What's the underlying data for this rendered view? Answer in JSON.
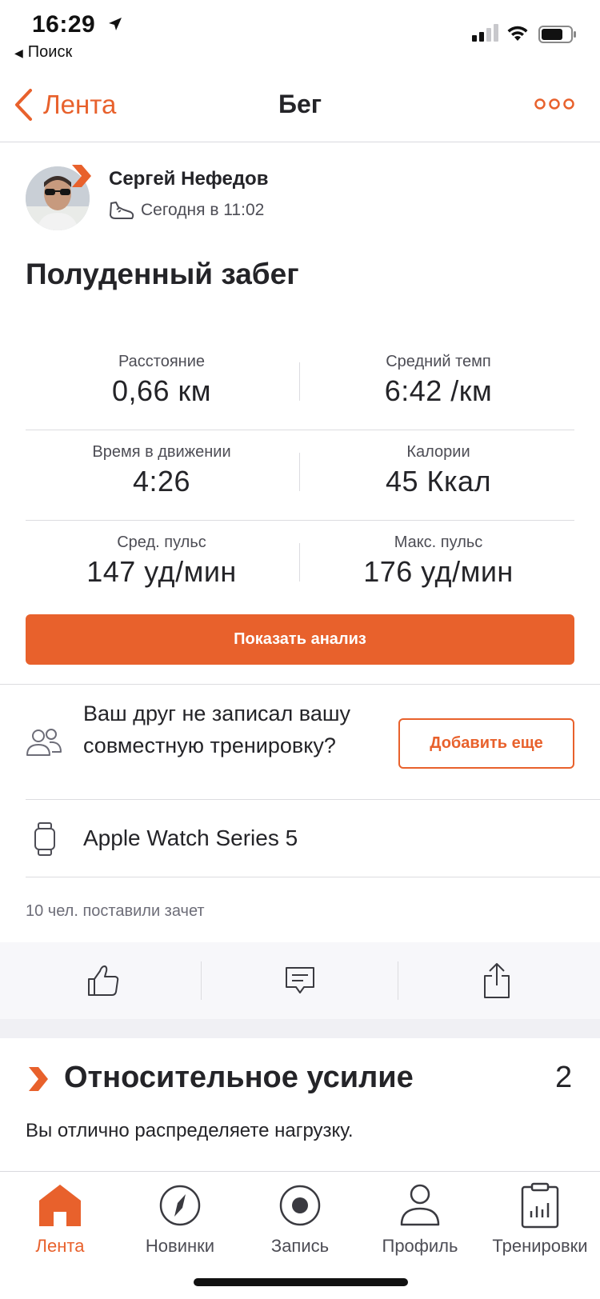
{
  "status_bar": {
    "time": "16:29",
    "back_app": "Поиск"
  },
  "nav": {
    "back_label": "Лента",
    "title": "Бег"
  },
  "author": {
    "name": "Сергей Нефедов",
    "date": "Сегодня в 11:02"
  },
  "activity": {
    "title": "Полуденный забег",
    "stats": [
      {
        "label": "Расстояние",
        "value": "0,66 км"
      },
      {
        "label": "Средний темп",
        "value": "6:42 /км"
      },
      {
        "label": "Время в движении",
        "value": "4:26"
      },
      {
        "label": "Калории",
        "value": "45 Ккал"
      },
      {
        "label": "Сред. пульс",
        "value": "147 уд/мин"
      },
      {
        "label": "Макс. пульс",
        "value": "176 уд/мин"
      }
    ],
    "analysis_button": "Показать анализ"
  },
  "friend_prompt": {
    "text": "Ваш друг не записал вашу совместную тренировку?",
    "button": "Добавить еще"
  },
  "device": {
    "name": "Apple Watch Series 5"
  },
  "kudos": {
    "text": "10 чел. поставили зачет"
  },
  "relative_effort": {
    "title": "Относительное усилие",
    "score": "2",
    "description": "Вы отлично распределяете нагрузку."
  },
  "tabs": [
    {
      "label": "Лента",
      "icon": "home-icon",
      "active": true
    },
    {
      "label": "Новинки",
      "icon": "compass-icon",
      "active": false
    },
    {
      "label": "Запись",
      "icon": "record-icon",
      "active": false
    },
    {
      "label": "Профиль",
      "icon": "profile-icon",
      "active": false
    },
    {
      "label": "Тренировки",
      "icon": "training-log-icon",
      "active": false
    }
  ],
  "colors": {
    "accent": "#e8612c",
    "text": "#242428",
    "secondary_text": "#4d4d55"
  }
}
